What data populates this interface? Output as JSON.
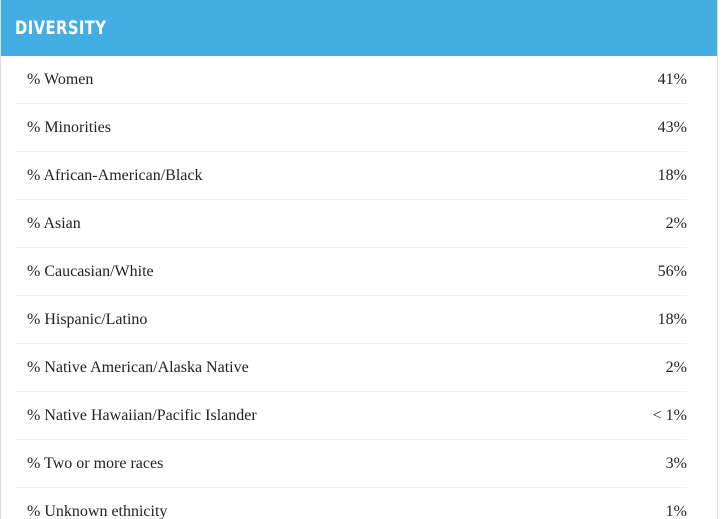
{
  "section": {
    "title": "DIVERSITY"
  },
  "rows": [
    {
      "label": "% Women",
      "value": "41%"
    },
    {
      "label": "% Minorities",
      "value": "43%"
    },
    {
      "label": "% African-American/Black",
      "value": "18%"
    },
    {
      "label": "% Asian",
      "value": "2%"
    },
    {
      "label": "% Caucasian/White",
      "value": "56%"
    },
    {
      "label": "% Hispanic/Latino",
      "value": "18%"
    },
    {
      "label": "% Native American/Alaska Native",
      "value": "2%"
    },
    {
      "label": "% Native Hawaiian/Pacific Islander",
      "value": "< 1%"
    },
    {
      "label": "% Two or more races",
      "value": "3%"
    },
    {
      "label": "% Unknown ethnicity",
      "value": "1%"
    }
  ],
  "colors": {
    "header_bg": "#44aee3",
    "header_text": "#ffffff",
    "divider": "#ececec"
  }
}
